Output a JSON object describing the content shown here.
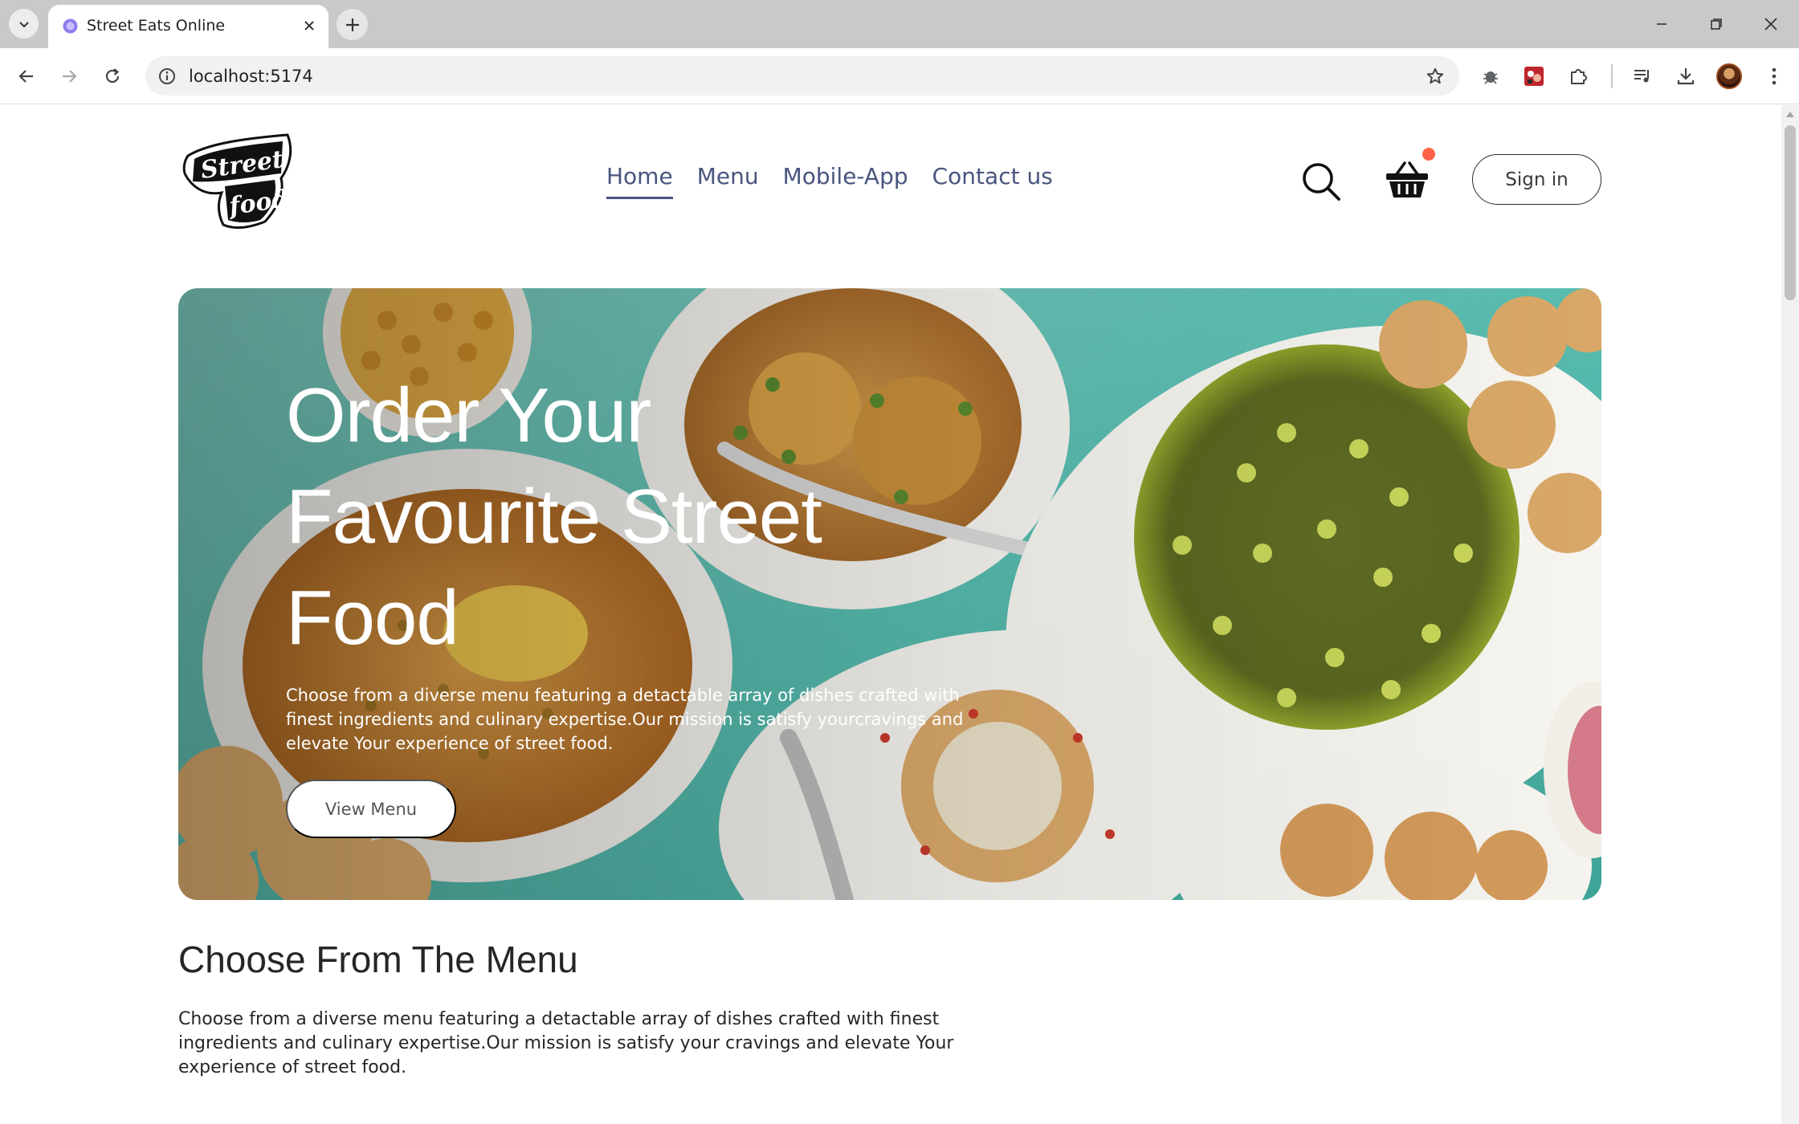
{
  "browser": {
    "tab_title": "Street Eats Online",
    "url": "localhost:5174",
    "icons": [
      "tab-list-icon",
      "favicon-icon",
      "close-tab-icon",
      "new-tab-icon",
      "minimize-icon",
      "restore-icon",
      "close-window-icon",
      "back-icon",
      "forward-icon",
      "reload-icon",
      "site-info-icon",
      "bookmark-star-icon",
      "extension-bug-icon",
      "extension-red-icon",
      "extensions-puzzle-icon",
      "media-queue-icon",
      "downloads-icon",
      "profile-avatar",
      "more-menu-icon"
    ]
  },
  "site": {
    "logo_text": "Street food",
    "nav": [
      {
        "label": "Home",
        "active": true
      },
      {
        "label": "Menu",
        "active": false
      },
      {
        "label": "Mobile-App",
        "active": false
      },
      {
        "label": "Contact us",
        "active": false
      }
    ],
    "sign_in": "Sign in",
    "accent_color": "#ff6347",
    "nav_color": "#49557e"
  },
  "hero": {
    "title": "Order Your Favourite Street Food",
    "text": "Choose from a diverse menu featuring a detactable array of dishes crafted with finest ingredients and culinary expertise.Our mission is satisfy yourcravings and elevate Your experience of street food.",
    "button": "View Menu"
  },
  "menu_section": {
    "title": "Choose From The Menu",
    "text": "Choose from a diverse menu featuring a detactable array of dishes crafted with finest ingredients and culinary expertise.Our mission is satisfy your cravings and elevate Your experience of street food."
  }
}
